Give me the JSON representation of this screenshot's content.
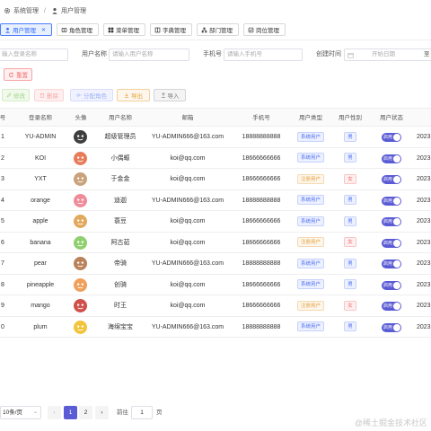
{
  "breadcrumb": {
    "parent": "系统管理",
    "current": "用户管理"
  },
  "tabs": [
    "用户管理",
    "角色管理",
    "菜单管理",
    "字典管理",
    "部门管理",
    "岗位管理"
  ],
  "filters": {
    "login_placeholder": "输入登录名称",
    "username_label": "用户名称",
    "username_placeholder": "请输入用户名称",
    "phone_label": "手机号",
    "phone_placeholder": "请输入手机号",
    "time_label": "创建时间",
    "start_placeholder": "开始日期",
    "end_label": "至",
    "reset": "重置"
  },
  "actions": {
    "edit": "修改",
    "delete": "删除",
    "assign_role": "分配角色",
    "export": "导出",
    "import": "导入"
  },
  "table": {
    "headers": [
      "号",
      "登录名称",
      "头像",
      "用户名称",
      "邮箱",
      "手机号",
      "用户类型",
      "用户性别",
      "用户状态",
      ""
    ],
    "status_label": "启用",
    "rows": [
      {
        "no": "1",
        "login": "YU-ADMIN",
        "avatar_color": "#3e3e3e",
        "name": "超级管理员",
        "email": "YU-ADMIN666@163.com",
        "phone": "18888888888",
        "type": "系统用户",
        "type_kind": "sys",
        "gender": "男",
        "gender_kind": "male",
        "date": "2023"
      },
      {
        "no": "2",
        "login": "KOI",
        "avatar_color": "#e87c5a",
        "name": "小偶螈",
        "email": "koi@qq.com",
        "phone": "18666666666",
        "type": "系统用户",
        "type_kind": "sys",
        "gender": "男",
        "gender_kind": "male",
        "date": "2023"
      },
      {
        "no": "3",
        "login": "YXT",
        "avatar_color": "#c9a27a",
        "name": "于金金",
        "email": "koi@qq.com",
        "phone": "18666666666",
        "type": "注册用户",
        "type_kind": "reg",
        "gender": "女",
        "gender_kind": "female",
        "date": "2023"
      },
      {
        "no": "4",
        "login": "orange",
        "avatar_color": "#f08c9a",
        "name": "迪迦",
        "email": "YU-ADMIN666@163.com",
        "phone": "18888888888",
        "type": "系统用户",
        "type_kind": "sys",
        "gender": "男",
        "gender_kind": "male",
        "date": "2023"
      },
      {
        "no": "5",
        "login": "apple",
        "avatar_color": "#e2a95c",
        "name": "蓑豆",
        "email": "koi@qq.com",
        "phone": "18666666666",
        "type": "系统用户",
        "type_kind": "sys",
        "gender": "男",
        "gender_kind": "male",
        "date": "2023"
      },
      {
        "no": "6",
        "login": "banana",
        "avatar_color": "#8fcf6e",
        "name": "阿古茹",
        "email": "koi@qq.com",
        "phone": "18666666666",
        "type": "注册用户",
        "type_kind": "reg",
        "gender": "女",
        "gender_kind": "female",
        "date": "2023"
      },
      {
        "no": "7",
        "login": "pear",
        "avatar_color": "#b9825a",
        "name": "帝骑",
        "email": "YU-ADMIN666@163.com",
        "phone": "18888888888",
        "type": "系统用户",
        "type_kind": "sys",
        "gender": "男",
        "gender_kind": "male",
        "date": "2023"
      },
      {
        "no": "8",
        "login": "pineapple",
        "avatar_color": "#f0a05a",
        "name": "创骑",
        "email": "koi@qq.com",
        "phone": "18666666666",
        "type": "系统用户",
        "type_kind": "sys",
        "gender": "男",
        "gender_kind": "male",
        "date": "2023"
      },
      {
        "no": "9",
        "login": "mango",
        "avatar_color": "#d0504a",
        "name": "时王",
        "email": "koi@qq.com",
        "phone": "18666666666",
        "type": "注册用户",
        "type_kind": "reg",
        "gender": "女",
        "gender_kind": "female",
        "date": "2023"
      },
      {
        "no": "0",
        "login": "plum",
        "avatar_color": "#f2c43a",
        "name": "海绵宝宝",
        "email": "YU-ADMIN666@163.com",
        "phone": "18888888888",
        "type": "系统用户",
        "type_kind": "sys",
        "gender": "男",
        "gender_kind": "male",
        "date": "2023"
      }
    ]
  },
  "pagination": {
    "page_size": "10条/页",
    "pages": [
      "1",
      "2"
    ],
    "current": "1",
    "goto_label": "前往",
    "goto_value": "1",
    "page_unit": "页"
  },
  "watermark": "@稀土掘金技术社区",
  "colors": {
    "primary": "#5b5bd6",
    "tab_active": "#2f6bff"
  }
}
